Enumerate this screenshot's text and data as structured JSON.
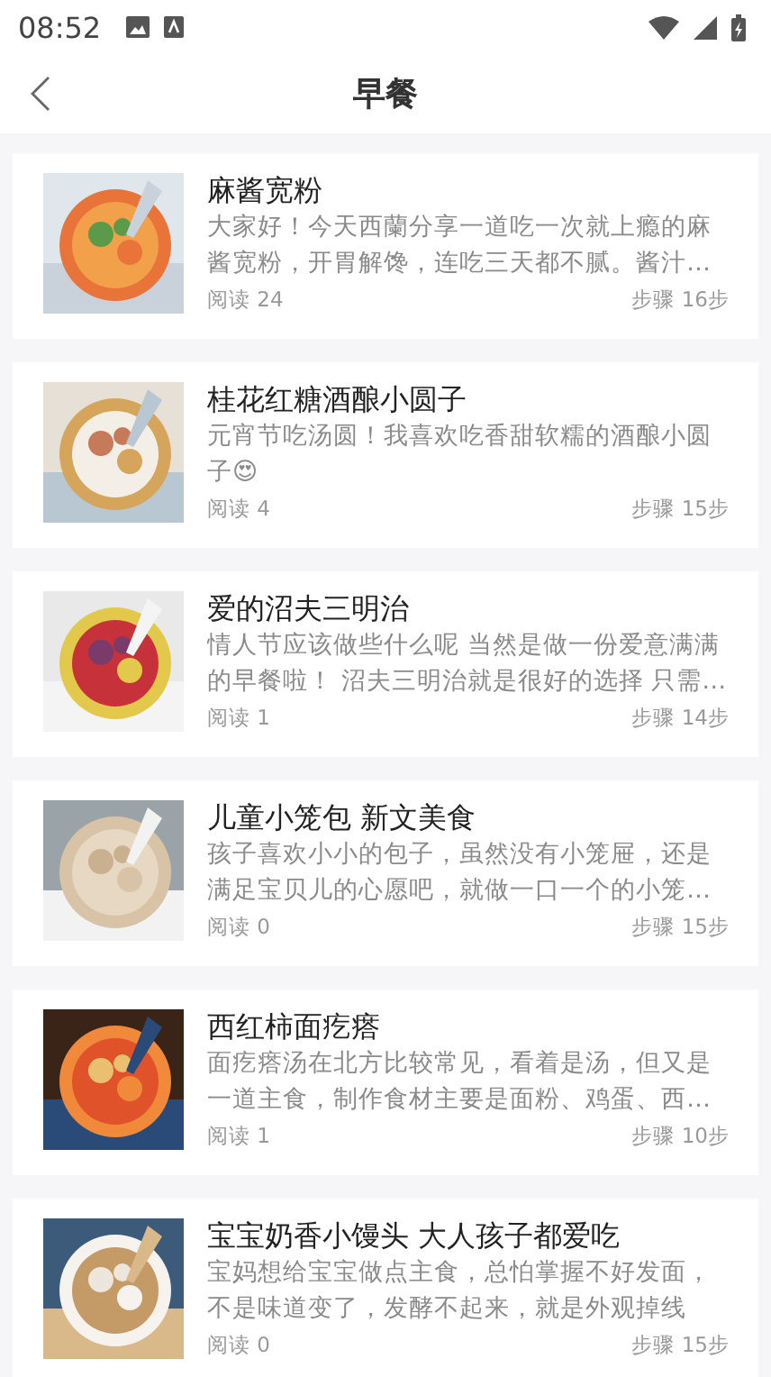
{
  "status_bar": {
    "time": "08:52"
  },
  "header": {
    "title": "早餐"
  },
  "recipes": [
    {
      "title": "麻酱宽粉",
      "description": "大家好！今天西蘭分享一道吃一次就上瘾的麻酱宽粉，开胃解馋，连吃三天都不腻。酱汁…",
      "reads": "阅读 24",
      "steps": "步骤 16步"
    },
    {
      "title": "桂花红糖酒酿小圆子",
      "description": "元宵节吃汤圆！我喜欢吃香甜软糯的酒酿小圆子😍",
      "reads": "阅读 4",
      "steps": "步骤 15步"
    },
    {
      "title": "爱的沼夫三明治",
      "description": "情人节应该做些什么呢 当然是做一份爱意满满的早餐啦！ 沼夫三明治就是很好的选择 只需…",
      "reads": "阅读 1",
      "steps": "步骤 14步"
    },
    {
      "title": "儿童小笼包 新文美食",
      "description": "孩子喜欢小小的包子，虽然没有小笼屉，还是满足宝贝儿的心愿吧，就做一口一个的小笼…",
      "reads": "阅读 0",
      "steps": "步骤 15步"
    },
    {
      "title": "西红柿面疙瘩",
      "description": "面疙瘩汤在北方比较常见，看着是汤，但又是一道主食，制作食材主要是面粉、鸡蛋、西…",
      "reads": "阅读 1",
      "steps": "步骤 10步"
    },
    {
      "title": "宝宝奶香小馒头 大人孩子都爱吃",
      "description": "宝妈想给宝宝做点主食，总怕掌握不好发面，不是味道变了，发酵不起来，就是外观掉线",
      "reads": "阅读 0",
      "steps": "步骤 15步"
    }
  ]
}
